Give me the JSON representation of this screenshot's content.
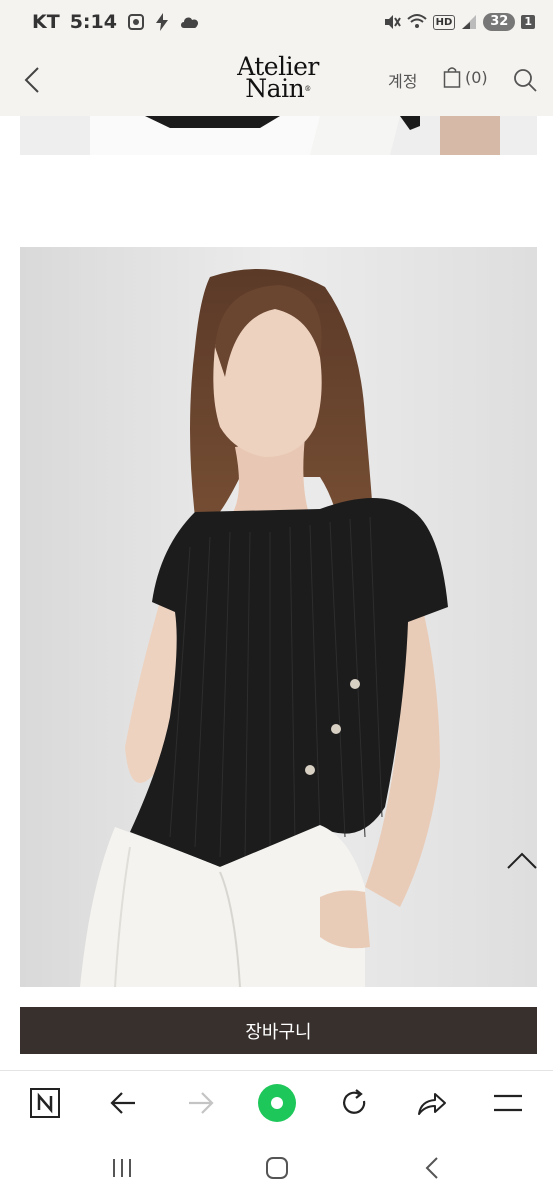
{
  "status_bar": {
    "carrier": "KT",
    "time": "5:14",
    "hd_label": "HD",
    "battery": "32",
    "sim": "1",
    "icons": [
      "screenshot-icon",
      "flash-icon",
      "cloud-icon",
      "mute-icon",
      "wifi-icon",
      "signal-icon"
    ]
  },
  "header": {
    "logo_line1": "Atelier",
    "logo_line2": "Nain",
    "logo_mark": "®",
    "account_label": "계정",
    "cart_count": "(0)"
  },
  "product": {
    "cart_button_label": "장바구니"
  },
  "toolbar": {
    "icons": [
      "naver-icon",
      "back-arrow-icon",
      "forward-arrow-icon",
      "home-dot-icon",
      "refresh-icon",
      "share-icon",
      "menu-icon"
    ]
  },
  "colors": {
    "header_bg": "#f5f3ef",
    "cart_button_bg": "#38302d",
    "accent_green": "#1ec75a"
  }
}
